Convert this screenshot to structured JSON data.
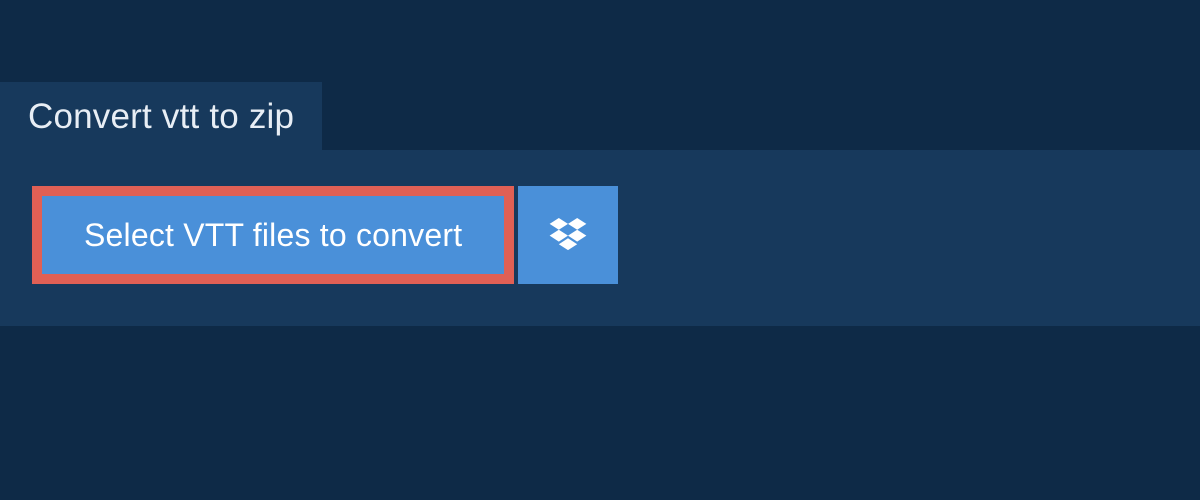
{
  "tab": {
    "title": "Convert vtt to zip"
  },
  "actions": {
    "select_label": "Select VTT files to convert"
  },
  "colors": {
    "page_bg": "#0e2a47",
    "panel_bg": "#17395c",
    "button_bg": "#4a90d9",
    "highlight_border": "#e06055",
    "text": "#e8eef5"
  },
  "icons": {
    "dropbox": "dropbox-icon"
  }
}
